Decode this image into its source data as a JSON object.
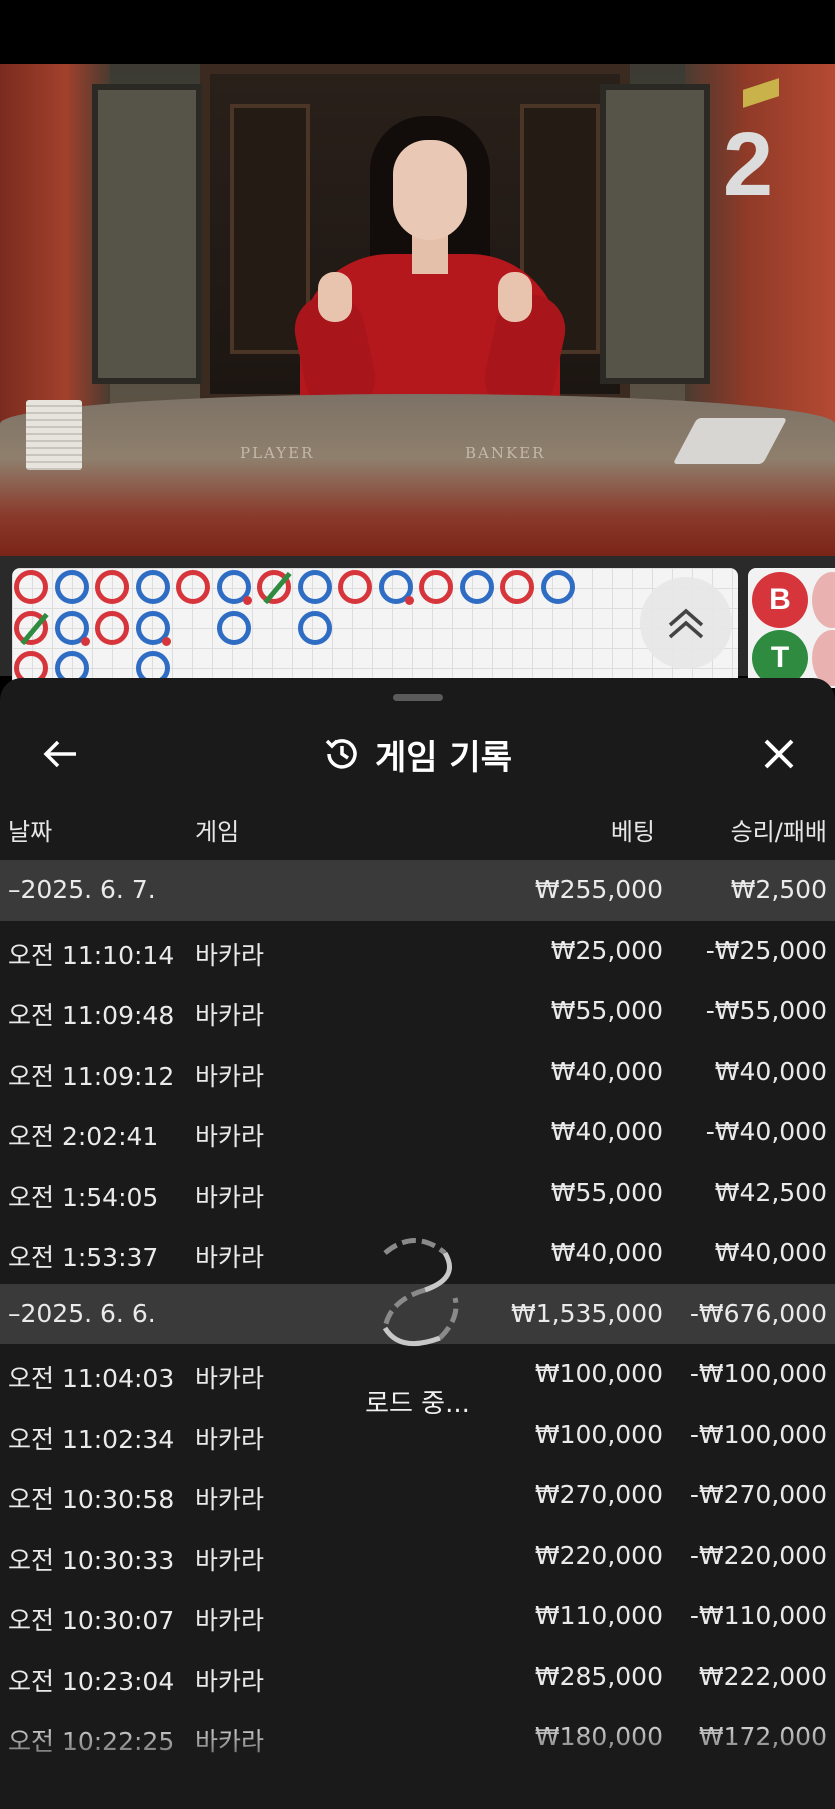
{
  "video": {
    "round_number": "2",
    "felt_player": "PLAYER",
    "felt_banker": "BANKER"
  },
  "roadmap": {
    "beads": [
      {
        "col": 0,
        "row": 0,
        "type": "banker"
      },
      {
        "col": 1,
        "row": 0,
        "type": "player"
      },
      {
        "col": 2,
        "row": 0,
        "type": "banker"
      },
      {
        "col": 3,
        "row": 0,
        "type": "player"
      },
      {
        "col": 4,
        "row": 0,
        "type": "banker"
      },
      {
        "col": 5,
        "row": 0,
        "type": "player",
        "dot": true
      },
      {
        "col": 6,
        "row": 0,
        "type": "banker",
        "tie": true
      },
      {
        "col": 7,
        "row": 0,
        "type": "player"
      },
      {
        "col": 8,
        "row": 0,
        "type": "banker"
      },
      {
        "col": 9,
        "row": 0,
        "type": "player",
        "dot": true
      },
      {
        "col": 10,
        "row": 0,
        "type": "banker"
      },
      {
        "col": 11,
        "row": 0,
        "type": "player"
      },
      {
        "col": 12,
        "row": 0,
        "type": "banker"
      },
      {
        "col": 13,
        "row": 0,
        "type": "player"
      },
      {
        "col": 0,
        "row": 1,
        "type": "banker",
        "tie": true
      },
      {
        "col": 1,
        "row": 1,
        "type": "player",
        "dot": true
      },
      {
        "col": 2,
        "row": 1,
        "type": "banker"
      },
      {
        "col": 3,
        "row": 1,
        "type": "player",
        "dot": true
      },
      {
        "col": 5,
        "row": 1,
        "type": "player"
      },
      {
        "col": 7,
        "row": 1,
        "type": "player"
      },
      {
        "col": 0,
        "row": 2,
        "type": "banker"
      },
      {
        "col": 1,
        "row": 2,
        "type": "player"
      },
      {
        "col": 3,
        "row": 2,
        "type": "player"
      }
    ],
    "bet_banker": "B",
    "bet_tie": "T"
  },
  "sheet": {
    "title": "게임 기록",
    "columns": {
      "date": "날짜",
      "game": "게임",
      "bet": "베팅",
      "win_loss": "승리/패배"
    },
    "rows": [
      {
        "group": true,
        "date": "–2025. 6. 7.",
        "game": "",
        "bet": "₩255,000",
        "win": "₩2,500"
      },
      {
        "group": false,
        "date": "오전 11:10:14",
        "game": "바카라",
        "bet": "₩25,000",
        "win": "-₩25,000"
      },
      {
        "group": false,
        "date": "오전 11:09:48",
        "game": "바카라",
        "bet": "₩55,000",
        "win": "-₩55,000"
      },
      {
        "group": false,
        "date": "오전 11:09:12",
        "game": "바카라",
        "bet": "₩40,000",
        "win": "₩40,000"
      },
      {
        "group": false,
        "date": "오전 2:02:41",
        "game": "바카라",
        "bet": "₩40,000",
        "win": "-₩40,000"
      },
      {
        "group": false,
        "date": "오전 1:54:05",
        "game": "바카라",
        "bet": "₩55,000",
        "win": "₩42,500"
      },
      {
        "group": false,
        "date": "오전 1:53:37",
        "game": "바카라",
        "bet": "₩40,000",
        "win": "₩40,000"
      },
      {
        "group": true,
        "date": "–2025. 6. 6.",
        "game": "",
        "bet": "₩1,535,000",
        "win": "-₩676,000"
      },
      {
        "group": false,
        "date": "오전 11:04:03",
        "game": "바카라",
        "bet": "₩100,000",
        "win": "-₩100,000"
      },
      {
        "group": false,
        "date": "오전 11:02:34",
        "game": "바카라",
        "bet": "₩100,000",
        "win": "-₩100,000"
      },
      {
        "group": false,
        "date": "오전 10:30:58",
        "game": "바카라",
        "bet": "₩270,000",
        "win": "-₩270,000"
      },
      {
        "group": false,
        "date": "오전 10:30:33",
        "game": "바카라",
        "bet": "₩220,000",
        "win": "-₩220,000"
      },
      {
        "group": false,
        "date": "오전 10:30:07",
        "game": "바카라",
        "bet": "₩110,000",
        "win": "-₩110,000"
      },
      {
        "group": false,
        "date": "오전 10:23:04",
        "game": "바카라",
        "bet": "₩285,000",
        "win": "₩222,000"
      },
      {
        "group": false,
        "date": "오전 10:22:25",
        "game": "바카라",
        "bet": "₩180,000",
        "win": "₩172,000"
      }
    ],
    "loading_text": "로드 중..."
  },
  "icons": {
    "back": "arrow-left-icon",
    "history": "history-icon",
    "close": "close-icon",
    "scroll_up": "double-chevron-up-icon",
    "loader": "spinner-icon"
  },
  "colors": {
    "banker": "#d6363b",
    "player": "#2f6dc4",
    "tie": "#2f8b3f",
    "sheet_bg": "#1a1a1a",
    "group_row_bg": "#3a3a3a"
  }
}
